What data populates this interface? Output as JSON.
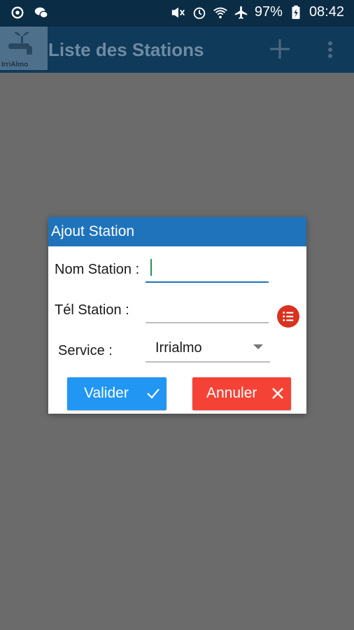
{
  "status_bar": {
    "battery": "97%",
    "time": "08:42",
    "icons": [
      "sync-icon",
      "chat-icon",
      "mute-icon",
      "alarm-icon",
      "wifi-icon",
      "airplane-icon",
      "battery-icon"
    ]
  },
  "app_bar": {
    "logo_text": "IrriAlmo",
    "title": "Liste des Stations",
    "actions": [
      "add-icon",
      "more-vert-icon"
    ]
  },
  "dialog": {
    "title": "Ajout Station",
    "fields": {
      "nom_label": "Nom Station :",
      "nom_value": "",
      "tel_label": "Tél Station :",
      "tel_value": "",
      "service_label": "Service :",
      "service_value": "Irrialmo"
    },
    "buttons": {
      "ok_label": "Valider",
      "cancel_label": "Annuler"
    }
  },
  "colors": {
    "status_bar": "#0b2c45",
    "app_bar": "#103a5a",
    "dialog_header": "#1e73bb",
    "ok_button": "#2196f3",
    "cancel_button": "#f44336",
    "list_button": "#d9321f",
    "overlay": "#6b6b6b"
  }
}
